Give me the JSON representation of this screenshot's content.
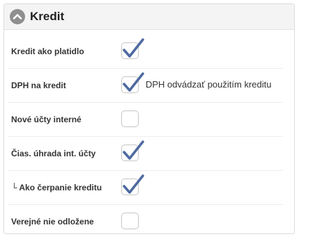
{
  "panel": {
    "title": "Kredit",
    "collapse_icon": "chevron-up-icon"
  },
  "rows": [
    {
      "label": "Kredit ako platidlo",
      "checked": true
    },
    {
      "label": "DPH na kredit",
      "checked": true,
      "inline_label": "DPH odvádzať použitím kreditu"
    },
    {
      "label": "Nové účty interné",
      "checked": false
    },
    {
      "label": "Čias. úhrada int. účty",
      "checked": true
    },
    {
      "label": "└ Ako čerpanie kreditu",
      "checked": true
    },
    {
      "label": "Verejné nie odložene",
      "checked": false
    }
  ],
  "colors": {
    "check": "#4f6aa1",
    "header_bg": "#f4f4f4",
    "collapse_btn": "#8f8f8f"
  }
}
